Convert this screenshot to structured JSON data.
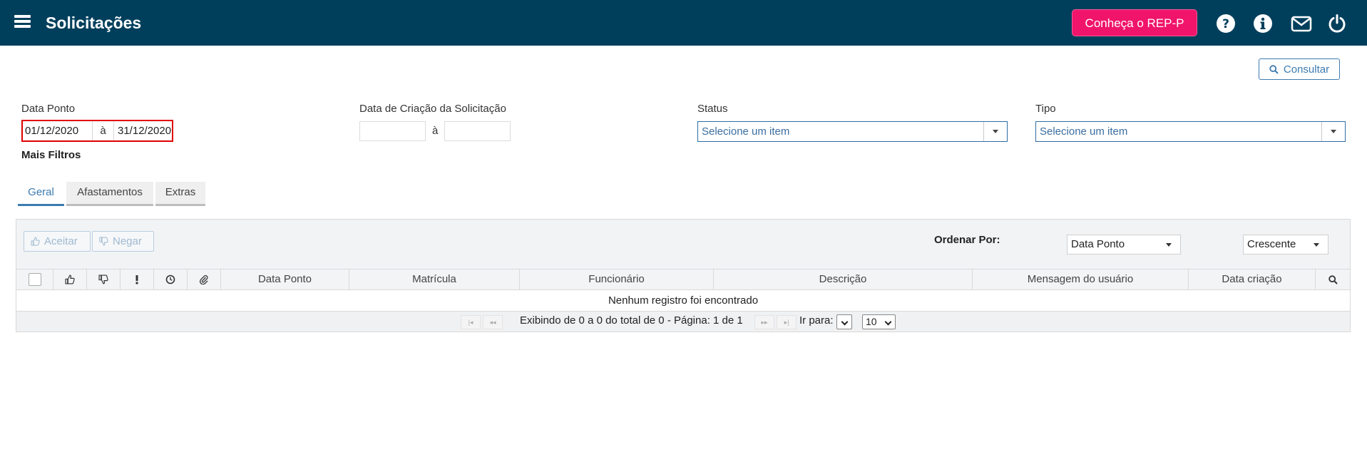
{
  "header": {
    "title": "Solicitações",
    "rep_button": "Conheça o REP-P",
    "icons": [
      "menu-icon",
      "help-icon",
      "info-icon",
      "mail-icon",
      "power-icon"
    ]
  },
  "toolbar": {
    "consultar_label": "Consultar"
  },
  "filters": {
    "data_ponto": {
      "label": "Data Ponto",
      "from": "01/12/2020",
      "separator": "à",
      "to": "31/12/2020"
    },
    "data_criacao": {
      "label": "Data de Criação da Solicitação",
      "separator": "à",
      "from": "",
      "to": ""
    },
    "status": {
      "label": "Status",
      "placeholder": "Selecione um item"
    },
    "tipo": {
      "label": "Tipo",
      "placeholder": "Selecione um item"
    },
    "mais_filtros": "Mais Filtros"
  },
  "tabs": [
    {
      "label": "Geral",
      "active": true
    },
    {
      "label": "Afastamentos",
      "active": false
    },
    {
      "label": "Extras",
      "active": false
    }
  ],
  "grid": {
    "accept_label": "Aceitar",
    "deny_label": "Negar",
    "order_by_label": "Ordenar Por:",
    "order_by_value": "Data Ponto",
    "order_dir_value": "Crescente",
    "columns": [
      "Data Ponto",
      "Matrícula",
      "Funcionário",
      "Descrição",
      "Mensagem do usuário",
      "Data criação"
    ],
    "empty_message": "Nenhum registro foi encontrado",
    "pager": {
      "info": "Exibindo de 0 a 0 do total de 0 - Página: 1 de 1",
      "goto_label": "Ir para:",
      "page_size": "10"
    }
  },
  "colors": {
    "header_bg": "#003f5c",
    "rep_button": "#f0146a",
    "accent": "#3d7bb0",
    "highlight_border": "#e00000"
  }
}
